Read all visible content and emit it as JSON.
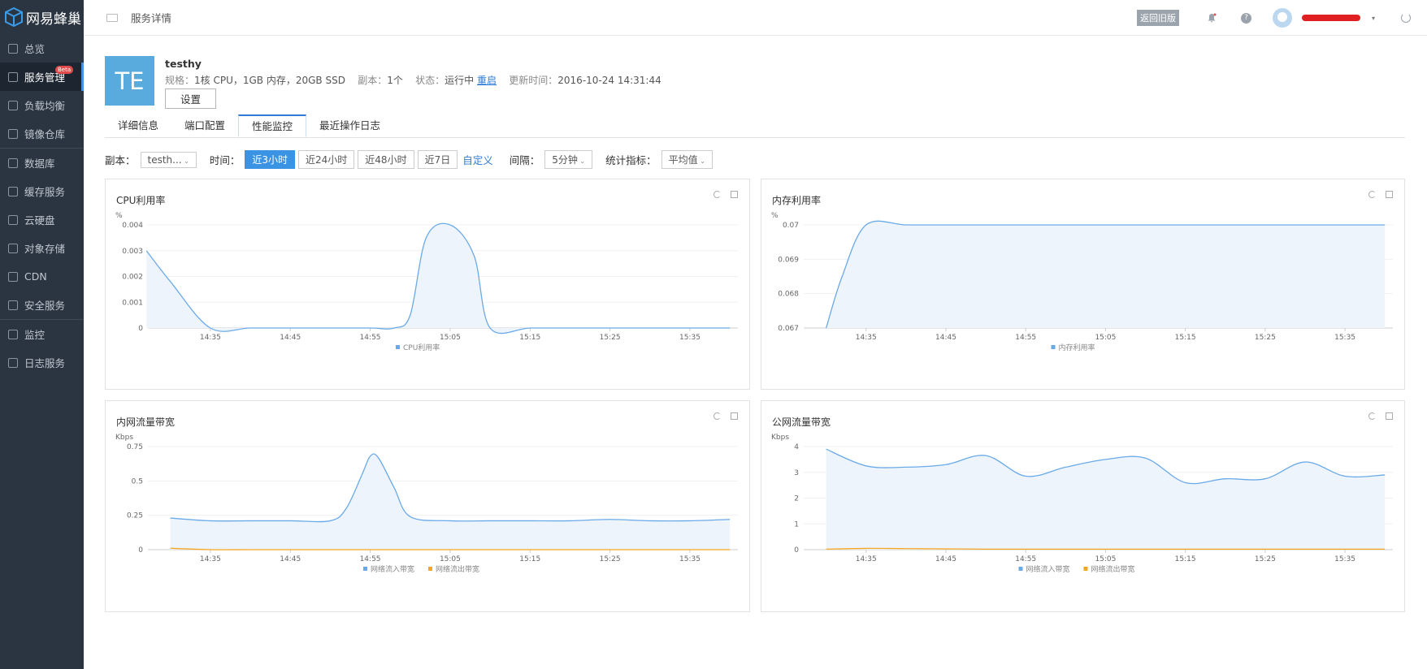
{
  "app": {
    "logo_text": "网易蜂巢"
  },
  "sidebar": {
    "items": [
      {
        "label": "总览",
        "icon": "bar-chart-icon"
      },
      {
        "label": "服务管理",
        "icon": "container-icon",
        "badge": "Beta"
      },
      {
        "label": "负载均衡",
        "icon": "network-icon"
      },
      {
        "label": "镜像仓库",
        "icon": "image-icon"
      },
      {
        "label": "数据库",
        "icon": "database-icon"
      },
      {
        "label": "缓存服务",
        "icon": "layers-icon"
      },
      {
        "label": "云硬盘",
        "icon": "disk-icon"
      },
      {
        "label": "对象存储",
        "icon": "cloud-icon"
      },
      {
        "label": "CDN",
        "icon": "cdn-icon"
      },
      {
        "label": "安全服务",
        "icon": "shield-icon"
      },
      {
        "label": "监控",
        "icon": "monitor-icon"
      },
      {
        "label": "日志服务",
        "icon": "log-icon"
      }
    ]
  },
  "topbar": {
    "title": "服务详情",
    "back_old": "返回旧版"
  },
  "service": {
    "icon_text": "TE",
    "name": "testhy",
    "spec_label": "规格：",
    "spec": "1核 CPU，1GB 内存，20GB SSD",
    "replica_label": "副本：",
    "replica": "1个",
    "status_label": "状态：",
    "status": "运行中",
    "restart": "重启",
    "updated_label": "更新时间：",
    "updated": "2016-10-24 14:31:44",
    "settings_btn": "设置"
  },
  "tabs": [
    "详细信息",
    "端口配置",
    "性能监控",
    "最近操作日志"
  ],
  "filters": {
    "replica_label": "副本：",
    "replica_value": "testh...",
    "time_label": "时间：",
    "ranges": [
      "近3小时",
      "近24小时",
      "近48小时",
      "近7日"
    ],
    "custom": "自定义",
    "interval_label": "间隔：",
    "interval_value": "5分钟",
    "metric_label": "统计指标：",
    "metric_value": "平均值"
  },
  "colors": {
    "in": "#6aaae8",
    "out": "#f5a623",
    "fill": "#edf4fb"
  },
  "chart_data": [
    {
      "id": "cpu",
      "type": "area",
      "title": "CPU利用率",
      "unit": "%",
      "yticks": [
        "0",
        "0.001",
        "0.002",
        "0.003",
        "0.004"
      ],
      "ylim": [
        0,
        0.004
      ],
      "xticks": [
        "14:35",
        "14:45",
        "14:55",
        "15:05",
        "15:15",
        "15:25",
        "15:35"
      ],
      "x": [
        "14:27",
        "14:30",
        "14:35",
        "14:40",
        "14:45",
        "14:50",
        "14:55",
        "14:58",
        "15:00",
        "15:02",
        "15:05",
        "15:08",
        "15:10",
        "15:15",
        "15:20",
        "15:25",
        "15:30",
        "15:35",
        "15:40"
      ],
      "series": [
        {
          "name": "CPU利用率",
          "values": [
            0.003,
            0.0018,
            0,
            0,
            0,
            0,
            0,
            0,
            0.0005,
            0.0035,
            0.004,
            0.0028,
            0,
            0,
            0,
            0,
            0,
            0,
            0
          ]
        }
      ]
    },
    {
      "id": "mem",
      "type": "area",
      "title": "内存利用率",
      "unit": "%",
      "yticks": [
        "0.067",
        "0.068",
        "0.069",
        "0.07"
      ],
      "ylim": [
        0.067,
        0.07
      ],
      "xticks": [
        "14:35",
        "14:45",
        "14:55",
        "15:05",
        "15:15",
        "15:25",
        "15:35"
      ],
      "x": [
        "14:30",
        "14:32",
        "14:35",
        "14:40",
        "14:45",
        "14:50",
        "14:55",
        "15:00",
        "15:05",
        "15:10",
        "15:15",
        "15:20",
        "15:25",
        "15:30",
        "15:35",
        "15:40"
      ],
      "series": [
        {
          "name": "内存利用率",
          "values": [
            0.067,
            0.0685,
            0.07,
            0.07,
            0.07,
            0.07,
            0.07,
            0.07,
            0.07,
            0.07,
            0.07,
            0.07,
            0.07,
            0.07,
            0.07,
            0.07
          ]
        }
      ]
    },
    {
      "id": "inner",
      "type": "area",
      "title": "内网流量带宽",
      "unit": "Kbps",
      "yticks": [
        "0",
        "0.25",
        "0.5",
        "0.75"
      ],
      "ylim": [
        0,
        0.75
      ],
      "xticks": [
        "14:35",
        "14:45",
        "14:55",
        "15:05",
        "15:15",
        "15:25",
        "15:35"
      ],
      "x": [
        "14:30",
        "14:35",
        "14:40",
        "14:45",
        "14:50",
        "14:52",
        "14:54",
        "14:55",
        "14:56",
        "14:58",
        "15:00",
        "15:05",
        "15:10",
        "15:15",
        "15:20",
        "15:25",
        "15:30",
        "15:35",
        "15:40"
      ],
      "series": [
        {
          "name": "网络流入带宽",
          "values": [
            0.23,
            0.21,
            0.21,
            0.21,
            0.21,
            0.3,
            0.55,
            0.68,
            0.67,
            0.45,
            0.24,
            0.21,
            0.21,
            0.21,
            0.21,
            0.22,
            0.21,
            0.21,
            0.22
          ]
        },
        {
          "name": "网络流出带宽",
          "values": [
            0.01,
            0,
            0,
            0,
            0,
            0,
            0,
            0,
            0,
            0,
            0,
            0,
            0,
            0,
            0,
            0,
            0,
            0,
            0
          ]
        }
      ]
    },
    {
      "id": "public",
      "type": "area",
      "title": "公网流量带宽",
      "unit": "Kbps",
      "yticks": [
        "0",
        "1",
        "2",
        "3",
        "4"
      ],
      "ylim": [
        0,
        4
      ],
      "xticks": [
        "14:35",
        "14:45",
        "14:55",
        "15:05",
        "15:15",
        "15:25",
        "15:35"
      ],
      "x": [
        "14:30",
        "14:35",
        "14:40",
        "14:45",
        "14:50",
        "14:55",
        "15:00",
        "15:05",
        "15:10",
        "15:15",
        "15:20",
        "15:25",
        "15:30",
        "15:35",
        "15:40"
      ],
      "series": [
        {
          "name": "网络流入带宽",
          "values": [
            3.9,
            3.25,
            3.2,
            3.3,
            3.65,
            2.85,
            3.2,
            3.5,
            3.55,
            2.6,
            2.75,
            2.75,
            3.4,
            2.85,
            2.9
          ]
        },
        {
          "name": "网络流出带宽",
          "values": [
            0.02,
            0.05,
            0.04,
            0.03,
            0.02,
            0.02,
            0.02,
            0.02,
            0.02,
            0.02,
            0.02,
            0.02,
            0.02,
            0.02,
            0.02
          ]
        }
      ]
    }
  ]
}
